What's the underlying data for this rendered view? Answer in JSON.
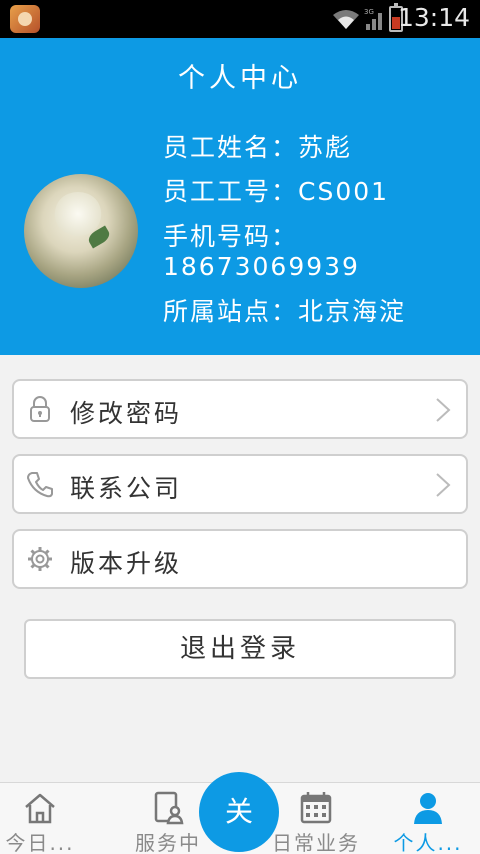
{
  "status_bar": {
    "time": "13:14"
  },
  "header": {
    "title": "个人中心",
    "name_line": "员工姓名：苏彪",
    "id_line": "员工工号：CS001",
    "phone_line": "手机号码：18673069939",
    "site_line": "所属站点：北京海淀"
  },
  "menu": {
    "items": [
      {
        "label": "修改密码",
        "icon": "lock-icon",
        "has_chevron": true
      },
      {
        "label": "联系公司",
        "icon": "phone-icon",
        "has_chevron": true
      },
      {
        "label": "版本升级",
        "icon": "gear-icon",
        "has_chevron": false
      }
    ],
    "logout_label": "退出登录"
  },
  "tabs": [
    {
      "label": "今日...",
      "icon": "home-icon"
    },
    {
      "label": "服务中",
      "icon": "service-icon"
    },
    {
      "label": "日常业务",
      "icon": "calendar-icon"
    },
    {
      "label": "个人...",
      "icon": "person-icon",
      "active": true
    }
  ],
  "fab": {
    "label": "关"
  },
  "colors": {
    "primary": "#0d9ae4",
    "background": "#f2f2f2"
  }
}
